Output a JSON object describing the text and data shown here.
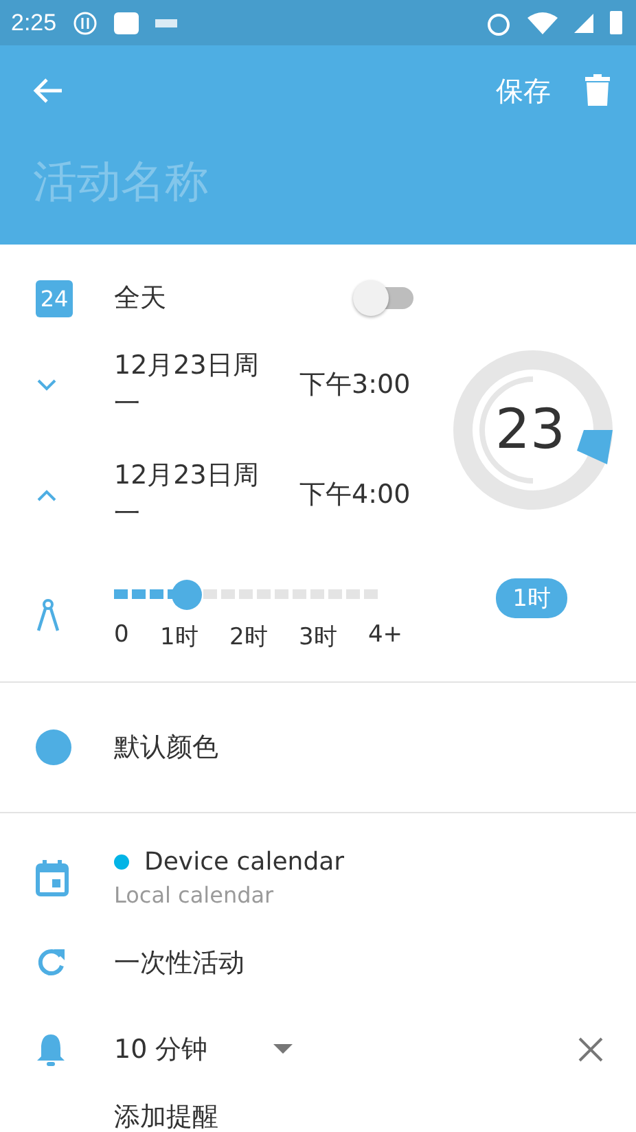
{
  "status_bar": {
    "time": "2:25"
  },
  "toolbar": {
    "save": "保存"
  },
  "title_field": {
    "placeholder": "活动名称"
  },
  "all_day": {
    "badge": "24",
    "label": "全天",
    "on": false
  },
  "start": {
    "date": "12月23日周一",
    "time": "下午3:00",
    "expanded": false
  },
  "end": {
    "date": "12月23日周一",
    "time": "下午4:00",
    "expanded": true
  },
  "dial": {
    "day": "23"
  },
  "duration": {
    "level": 0.25,
    "ticks": [
      "0",
      "1时",
      "2时",
      "3时",
      "4+"
    ],
    "badge": "1时"
  },
  "color": {
    "label": "默认颜色",
    "color": "#4eaee3"
  },
  "calendar": {
    "name": "Device calendar",
    "account": "Local calendar",
    "color": "#03b4e6"
  },
  "repeat": {
    "label": "一次性活动"
  },
  "reminders": [
    {
      "value": "10 分钟"
    }
  ],
  "add_reminder": "添加提醒"
}
